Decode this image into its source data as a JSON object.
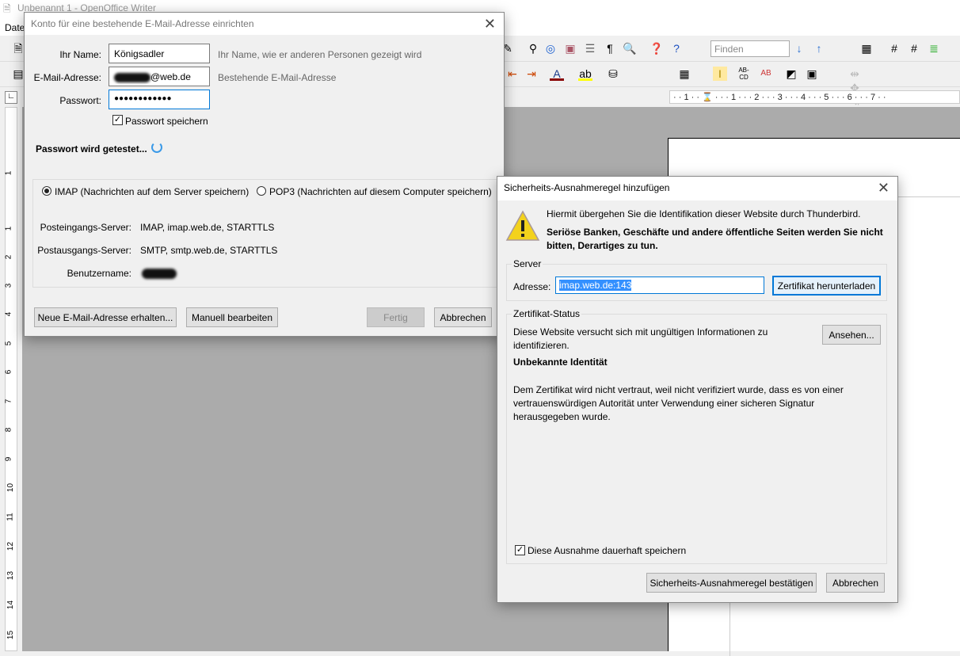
{
  "app": {
    "title": "Unbenannt 1 - OpenOffice Writer",
    "menu_first": "Date"
  },
  "toolbar": {
    "find_placeholder": "Finden"
  },
  "ruler": {
    "h": "· · 1 · · ⌛ · · · 1 · · · 2 · · · 3 · · · 4 · · · 5 · · · 6 · · · 7 · ·",
    "v": [
      "1",
      "1",
      "2",
      "3",
      "4",
      "5",
      "6",
      "7",
      "8",
      "9",
      "10",
      "11",
      "12",
      "13",
      "14",
      "15"
    ]
  },
  "account_dialog": {
    "title": "Konto für eine bestehende E-Mail-Adresse einrichten",
    "name_label": "Ihr Name:",
    "name_value": "Königsadler",
    "name_hint": "Ihr Name, wie er anderen Personen gezeigt wird",
    "email_label": "E-Mail-Adresse:",
    "email_value_suffix": "@web.de",
    "email_hint": "Bestehende E-Mail-Adresse",
    "password_label": "Passwort:",
    "password_value": "●●●●●●●●●●●●",
    "save_password": "Passwort speichern",
    "save_password_checked": true,
    "status": "Passwort wird getestet...",
    "imap_label": "IMAP (Nachrichten auf dem Server speichern)",
    "pop3_label": "POP3 (Nachrichten auf diesem Computer speichern)",
    "selected_protocol": "IMAP",
    "incoming_label": "Posteingangs-Server:",
    "incoming_value": "IMAP, imap.web.de, STARTTLS",
    "outgoing_label": "Postausgangs-Server:",
    "outgoing_value": "SMTP, smtp.web.de, STARTTLS",
    "username_label": "Benutzername:",
    "btn_new": "Neue E-Mail-Adresse erhalten...",
    "btn_manual": "Manuell bearbeiten",
    "btn_done": "Fertig",
    "btn_cancel": "Abbrechen"
  },
  "security_dialog": {
    "title": "Sicherheits-Ausnahmeregel hinzufügen",
    "warning_text": "Hiermit übergehen Sie die Identifikation dieser Website durch Thunderbird.",
    "warning_bold": "Seriöse Banken, Geschäfte und andere öffentliche Seiten werden Sie nicht bitten, Derartiges zu tun.",
    "server_group": "Server",
    "address_label": "Adresse:",
    "address_value": "imap.web.de:143",
    "btn_download": "Zertifikat herunterladen",
    "status_group": "Zertifikat-Status",
    "status_text": "Diese Website versucht sich mit ungültigen Informationen zu identifizieren.",
    "btn_view": "Ansehen...",
    "identity_title": "Unbekannte Identität",
    "identity_text": "Dem Zertifikat wird nicht vertraut, weil nicht verifiziert wurde, dass es von einer vertrauenswürdigen Autorität unter Verwendung einer sicheren Signatur herausgegeben wurde.",
    "permanent_label": "Diese Ausnahme dauerhaft speichern",
    "permanent_checked": true,
    "btn_confirm": "Sicherheits-Ausnahmeregel bestätigen",
    "btn_cancel": "Abbrechen"
  }
}
